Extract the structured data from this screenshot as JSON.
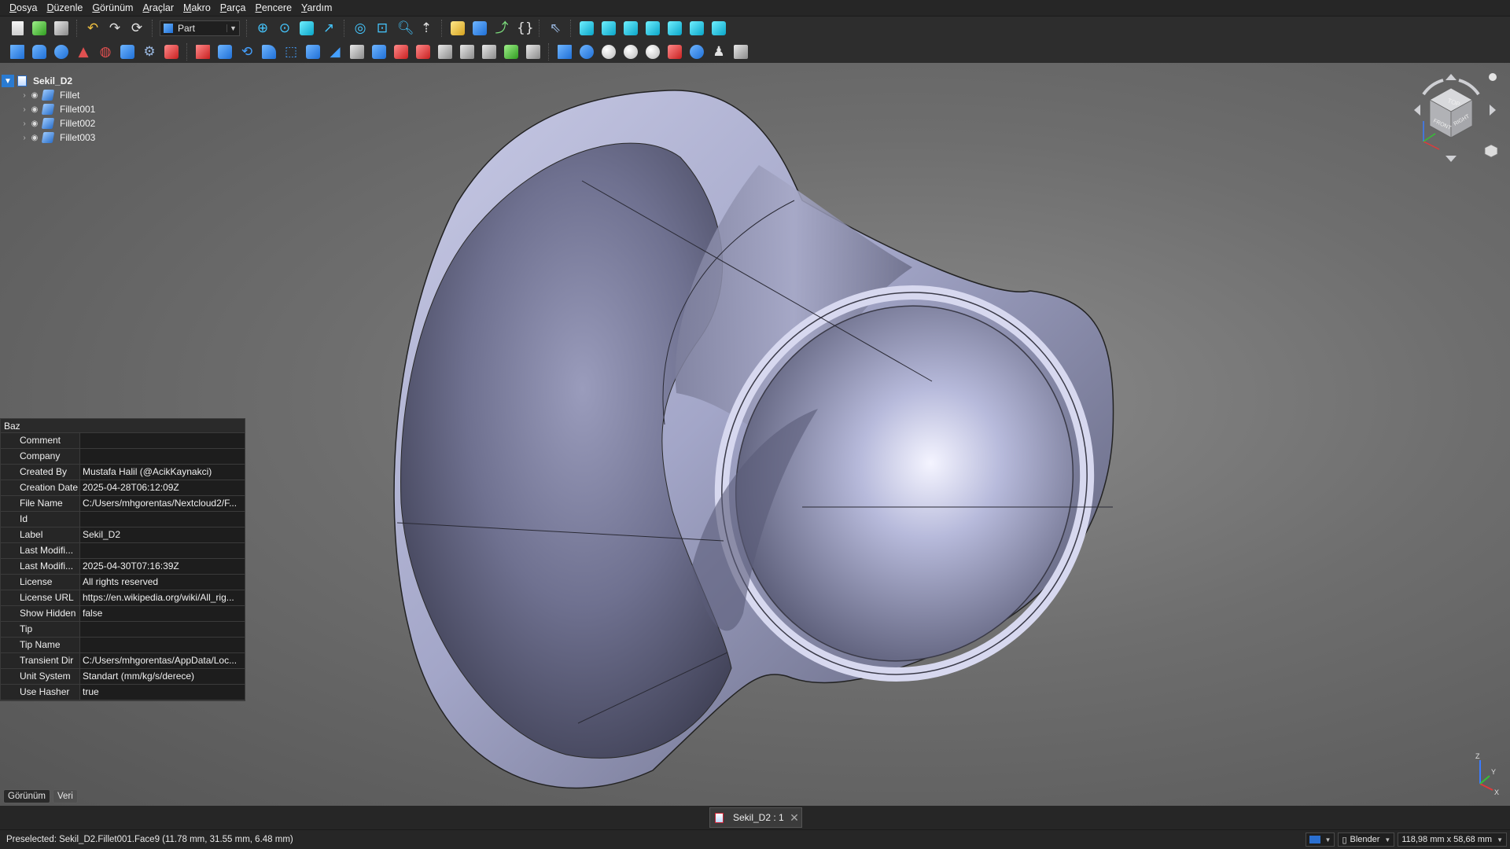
{
  "menubar": {
    "items": [
      "Dosya",
      "Düzenle",
      "Görünüm",
      "Araçlar",
      "Makro",
      "Parça",
      "Pencere",
      "Yardım"
    ]
  },
  "toolbar": {
    "workbench": "Part"
  },
  "tree": {
    "root": "Sekil_D2",
    "items": [
      "Fillet",
      "Fillet001",
      "Fillet002",
      "Fillet003"
    ]
  },
  "properties": {
    "group": "Baz",
    "rows": [
      {
        "name": "Comment",
        "value": ""
      },
      {
        "name": "Company",
        "value": ""
      },
      {
        "name": "Created By",
        "value": "Mustafa Halil (@AcikKaynakci)"
      },
      {
        "name": "Creation Date",
        "value": "2025-04-28T06:12:09Z"
      },
      {
        "name": "File Name",
        "value": "C:/Users/mhgorentas/Nextcloud2/F..."
      },
      {
        "name": "Id",
        "value": ""
      },
      {
        "name": "Label",
        "value": "Sekil_D2"
      },
      {
        "name": "Last Modifi...",
        "value": ""
      },
      {
        "name": "Last Modifi...",
        "value": "2025-04-30T07:16:39Z"
      },
      {
        "name": "License",
        "value": "All rights reserved"
      },
      {
        "name": "License URL",
        "value": "https://en.wikipedia.org/wiki/All_rig..."
      },
      {
        "name": "Show Hidden",
        "value": "false"
      },
      {
        "name": "Tip",
        "value": ""
      },
      {
        "name": "Tip Name",
        "value": ""
      },
      {
        "name": "Transient Dir",
        "value": "C:/Users/mhgorentas/AppData/Loc..."
      },
      {
        "name": "Unit System",
        "value": "Standart (mm/kg/s/derece)"
      },
      {
        "name": "Use Hasher",
        "value": "true"
      }
    ]
  },
  "panel_tabs": {
    "view": "Görünüm",
    "data": "Veri"
  },
  "document_tab": {
    "label": "Sekil_D2 : 1"
  },
  "status": {
    "text": "Preselected: Sekil_D2.Fillet001.Face9 (11.78 mm, 31.55 mm, 6.48 mm)",
    "nav_style": "Blender",
    "dimensions": "118,98 mm x 58,68 mm"
  },
  "navcube": {
    "top": "TOP",
    "front": "FRONT",
    "right": "RIGHT"
  },
  "axes": {
    "x": "X",
    "y": "Y",
    "z": "Z"
  }
}
